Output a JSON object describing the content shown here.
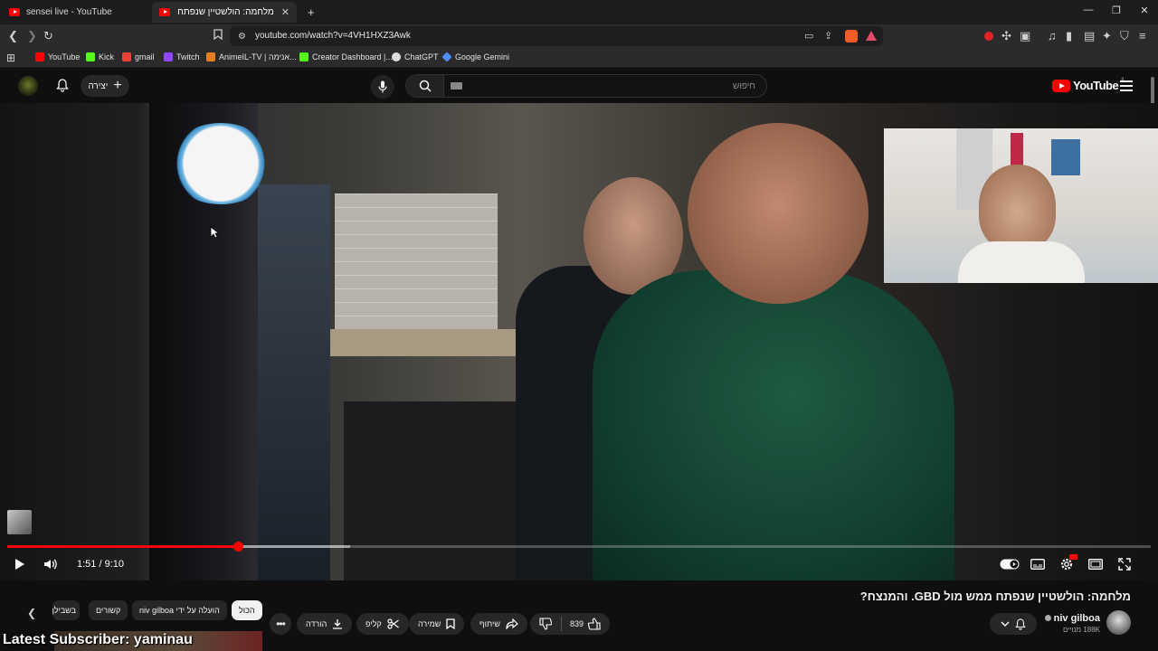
{
  "browser": {
    "tabs": [
      {
        "title": "sensei live - YouTube"
      },
      {
        "title": "מלחמה: הולשטיין שנפתח ממש מ"
      }
    ],
    "new_tab": "+",
    "url": "youtube.com/watch?v=4VH1HXZ3Awk",
    "bookmarks": [
      {
        "label": "YouTube",
        "color": "#ff0000"
      },
      {
        "label": "Kick",
        "color": "#53fc18"
      },
      {
        "label": "gmail",
        "color": "#ea4335"
      },
      {
        "label": "Twitch",
        "color": "#9146ff"
      },
      {
        "label": "AnimeIL-TV | אנימה...",
        "color": "#e67e22"
      },
      {
        "label": "Creator Dashboard |...",
        "color": "#53fc18"
      },
      {
        "label": "ChatGPT",
        "color": "#dddddd"
      },
      {
        "label": "Google Gemini",
        "color": "#4f8df5"
      }
    ]
  },
  "header": {
    "create_label": "יצירה",
    "search_placeholder": "חיפוש",
    "logo_text": "YouTube",
    "logo_region": "IL"
  },
  "player": {
    "current_time": "1:51",
    "duration": "9:10",
    "time_display": "1:51 / 9:10",
    "progress": 0.2018,
    "buffered": 0.3,
    "accent_color": "#ff0000"
  },
  "video": {
    "title": "מלחמה: הולשטיין שנפתח ממש מול GBD. והמנצח?",
    "channel_name": "niv gilboa",
    "subscribers": "188K מנויים",
    "likes": "839",
    "share_label": "שיתוף",
    "save_label": "שמירה",
    "clip_label": "קליפ",
    "download_label": "הורדה"
  },
  "chips": [
    {
      "label": "הכול",
      "selected": true
    },
    {
      "label": "הועלה על ידי niv gilboa",
      "selected": false
    },
    {
      "label": "קשורים",
      "selected": false
    },
    {
      "label": "בשבילך",
      "selected": false
    }
  ],
  "overlay": {
    "latest_subscriber": "Latest Subscriber: yaminau"
  }
}
